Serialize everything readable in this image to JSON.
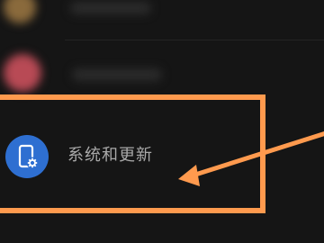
{
  "settings_list": {
    "items": [
      {
        "label": "",
        "icon": "blurred-icon",
        "color": "#b68a4a"
      },
      {
        "label": "",
        "icon": "blurred-icon",
        "color": "#c2555e"
      },
      {
        "label": "系统和更新",
        "icon": "phone-gear-icon",
        "color": "#2e6fd1"
      }
    ]
  },
  "annotation": {
    "highlight_color": "#ff9a4e"
  }
}
